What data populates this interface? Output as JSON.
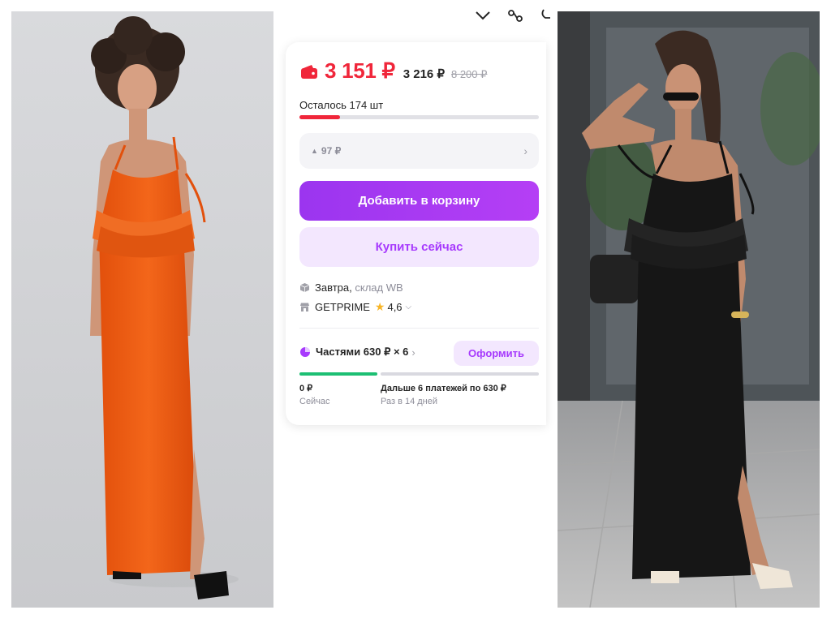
{
  "pricing": {
    "current_price": "3 151 ₽",
    "wallet_price": "3 216 ₽",
    "old_price": "8 200 ₽"
  },
  "stock": {
    "label": "Осталось 174 шт",
    "fill_fraction": 0.17
  },
  "price_drop": {
    "value": "97 ₽"
  },
  "buttons": {
    "add_to_cart": "Добавить в корзину",
    "buy_now": "Купить сейчас"
  },
  "delivery": {
    "day": "Завтра,",
    "warehouse": "склад WB"
  },
  "seller": {
    "name": "GETPRIME",
    "rating": "4,6"
  },
  "installments": {
    "title": "Частями 630 ₽ × 6",
    "arrange_label": "Оформить",
    "now_amount": "0 ₽",
    "now_label": "Сейчас",
    "rest_amount": "Дальше 6 платежей по 630 ₽",
    "rest_label": "Раз в 14 дней"
  },
  "colors": {
    "accent": "#a73afd",
    "price_red": "#f0263a",
    "success_green": "#1dbf73",
    "star": "#f8b527"
  }
}
